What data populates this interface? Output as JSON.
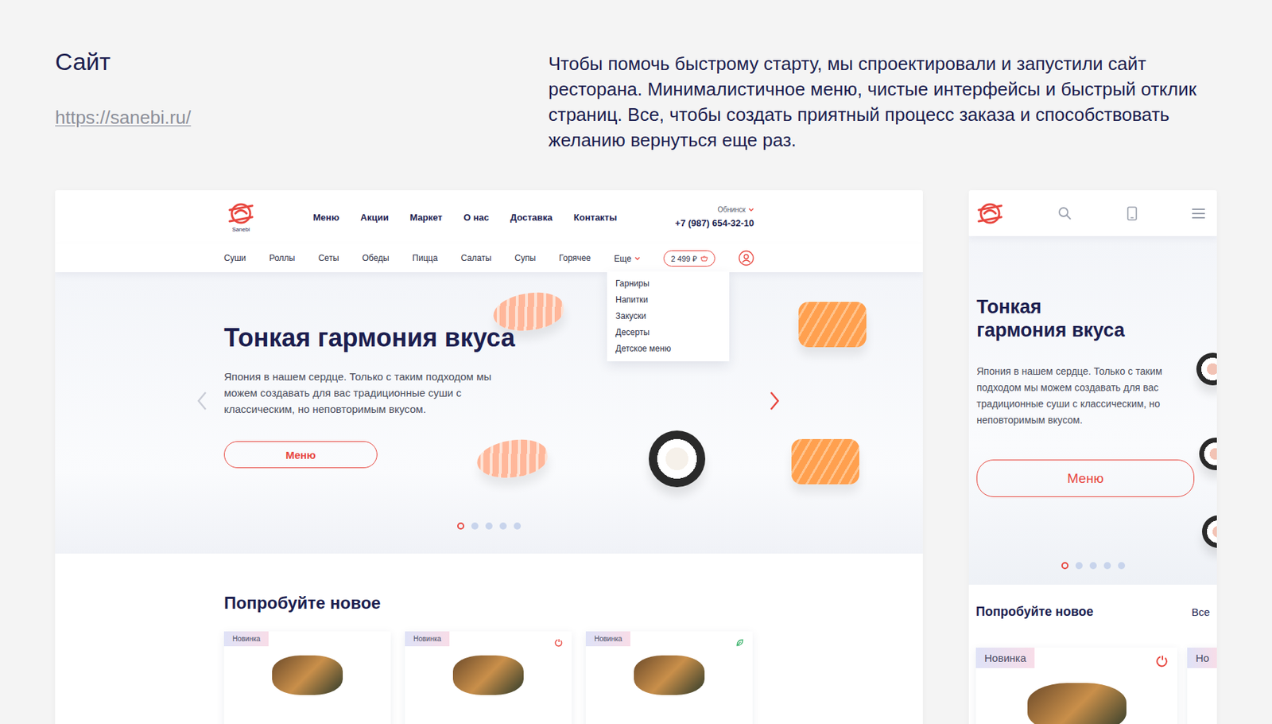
{
  "page": {
    "title": "Сайт",
    "link": "https://sanebi.ru/",
    "description": "Чтобы помочь быстрому старту, мы спроектировали и запустили сайт ресторана. Минималистичное меню, чистые интерфейсы и быстрый отклик страниц. Все, чтобы создать приятный процесс заказа и способствовать желанию вернуться еще раз."
  },
  "desktop": {
    "logo": "Sanebi",
    "nav": [
      "Меню",
      "Акции",
      "Маркет",
      "О нас",
      "Доставка",
      "Контакты"
    ],
    "city": "Обнинск",
    "phone": "+7 (987) 654-32-10",
    "categories": [
      "Суши",
      "Роллы",
      "Сеты",
      "Обеды",
      "Пицца",
      "Салаты",
      "Супы",
      "Горячее"
    ],
    "more": {
      "label": "Еще",
      "expanded": true,
      "items": [
        "Гарниры",
        "Напитки",
        "Закуски",
        "Десерты",
        "Детское меню"
      ]
    },
    "cart": "2 499 ₽",
    "hero": {
      "title": "Тонкая гармония вкуса",
      "text": "Япония в нашем сердце. Только с таким подходом мы можем создавать для вас традиционные суши с классическим,  но неповторимым вкусом.",
      "button": "Меню",
      "prev": {
        "disabled": true
      },
      "next": {
        "disabled": false
      },
      "slides": [
        {
          "selected": true
        },
        {
          "selected": false
        },
        {
          "selected": false
        },
        {
          "selected": false
        },
        {
          "selected": false
        }
      ]
    },
    "section": "Попробуйте новое",
    "cards": [
      {
        "badge": "Новинка",
        "kind": "none"
      },
      {
        "badge": "Новинка",
        "kind": "spicy"
      },
      {
        "badge": "Новинка",
        "kind": "veg"
      }
    ]
  },
  "mobile": {
    "hero": {
      "title": "Тонкая гармония вкуса",
      "text": "Япония в нашем сердце. Только с таким подходом мы можем создавать для вас традиционные суши с классическим, но неповторимым вкусом.",
      "button": "Меню",
      "slides": [
        {
          "selected": true
        },
        {
          "selected": false
        },
        {
          "selected": false
        },
        {
          "selected": false
        },
        {
          "selected": false
        }
      ]
    },
    "section": "Попробуйте новое",
    "all": "Все",
    "cards": [
      {
        "badge": "Новинка",
        "kind": "spicy"
      },
      {
        "badge": "Но",
        "kind": "none"
      }
    ]
  }
}
